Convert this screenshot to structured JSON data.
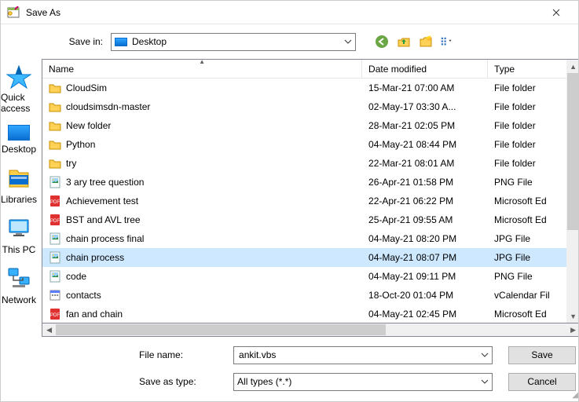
{
  "window": {
    "title": "Save As"
  },
  "savein": {
    "label": "Save in:",
    "value": "Desktop"
  },
  "columns": {
    "name": "Name",
    "date": "Date modified",
    "type": "Type"
  },
  "files": [
    {
      "icon": "folder",
      "name": "CloudSim",
      "date": "15-Mar-21 07:00 AM",
      "type": "File folder"
    },
    {
      "icon": "folder",
      "name": "cloudsimsdn-master",
      "date": "02-May-17 03:30 A...",
      "type": "File folder"
    },
    {
      "icon": "folder",
      "name": "New folder",
      "date": "28-Mar-21 02:05 PM",
      "type": "File folder"
    },
    {
      "icon": "folder",
      "name": "Python",
      "date": "04-May-21 08:44 PM",
      "type": "File folder"
    },
    {
      "icon": "folder",
      "name": "try",
      "date": "22-Mar-21 08:01 AM",
      "type": "File folder"
    },
    {
      "icon": "png",
      "name": "3 ary tree question",
      "date": "26-Apr-21 01:58 PM",
      "type": "PNG File"
    },
    {
      "icon": "pdf",
      "name": "Achievement test",
      "date": "22-Apr-21 06:22 PM",
      "type": "Microsoft Ed"
    },
    {
      "icon": "pdf",
      "name": "BST and AVL tree",
      "date": "25-Apr-21 09:55 AM",
      "type": "Microsoft Ed"
    },
    {
      "icon": "jpg",
      "name": "chain process final",
      "date": "04-May-21 08:20 PM",
      "type": "JPG File"
    },
    {
      "icon": "jpg",
      "name": "chain process",
      "date": "04-May-21 08:07 PM",
      "type": "JPG File",
      "selected": true
    },
    {
      "icon": "png",
      "name": "code",
      "date": "04-May-21 09:11 PM",
      "type": "PNG File"
    },
    {
      "icon": "vcal",
      "name": "contacts",
      "date": "18-Oct-20 01:04 PM",
      "type": "vCalendar Fil"
    },
    {
      "icon": "pdf",
      "name": "fan and chain",
      "date": "04-May-21 02:45 PM",
      "type": "Microsoft Ed"
    }
  ],
  "places": {
    "quick": "Quick access",
    "desktop": "Desktop",
    "libraries": "Libraries",
    "thispc": "This PC",
    "network": "Network"
  },
  "form": {
    "filename_label": "File name:",
    "filename_value": "ankit.vbs",
    "saveastype_label": "Save as type:",
    "saveastype_value": "All types (*.*)",
    "save": "Save",
    "cancel": "Cancel"
  }
}
